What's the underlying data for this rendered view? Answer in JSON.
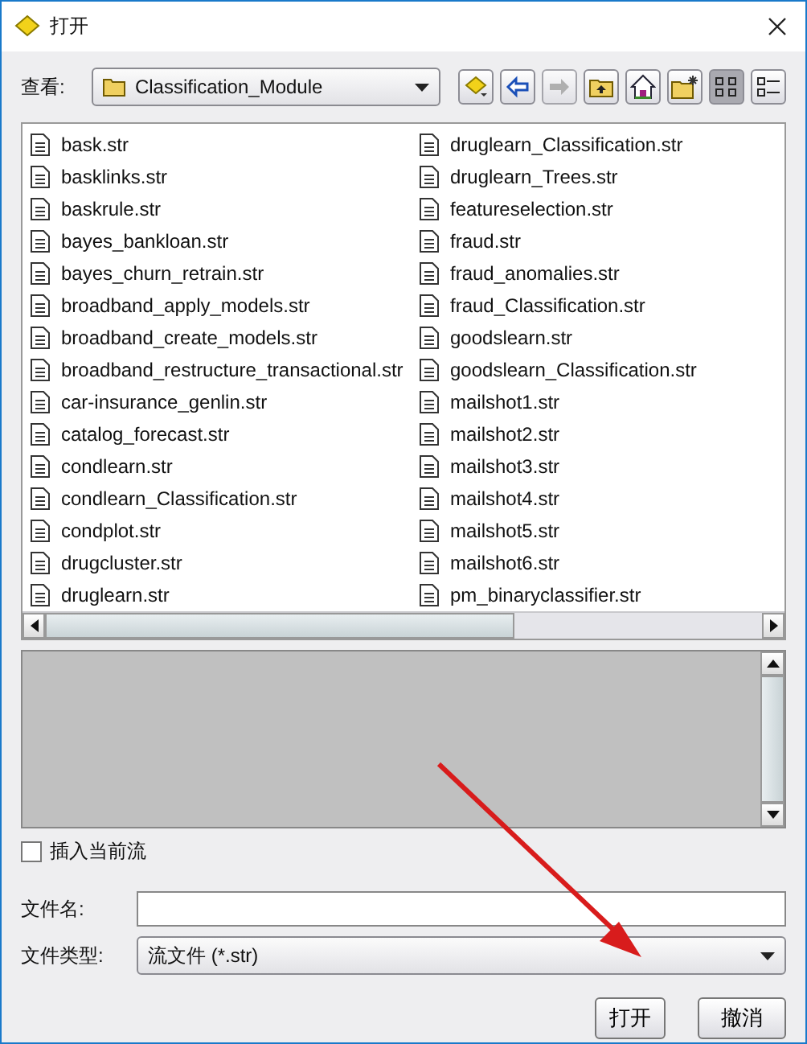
{
  "window": {
    "title": "打开"
  },
  "look_in": {
    "label": "查看:",
    "folder": "Classification_Module"
  },
  "toolbar": [
    {
      "kind": "desktop",
      "disabled": false,
      "selected": false
    },
    {
      "kind": "back",
      "disabled": false,
      "selected": false
    },
    {
      "kind": "forward",
      "disabled": true,
      "selected": false
    },
    {
      "kind": "up",
      "disabled": false,
      "selected": false
    },
    {
      "kind": "home",
      "disabled": false,
      "selected": false
    },
    {
      "kind": "newfolder",
      "disabled": false,
      "selected": false
    },
    {
      "kind": "list",
      "disabled": false,
      "selected": true
    },
    {
      "kind": "details",
      "disabled": false,
      "selected": false
    }
  ],
  "files": [
    "bask.str",
    "basklinks.str",
    "baskrule.str",
    "bayes_bankloan.str",
    "bayes_churn_retrain.str",
    "broadband_apply_models.str",
    "broadband_create_models.str",
    "broadband_restructure_transactional.str",
    "car-insurance_genlin.str",
    "catalog_forecast.str",
    "condlearn.str",
    "condlearn_Classification.str",
    "condplot.str",
    "drugcluster.str",
    "druglearn.str",
    "druglearn_Classification.str",
    "druglearn_Trees.str",
    "featureselection.str",
    "fraud.str",
    "fraud_anomalies.str",
    "fraud_Classification.str",
    "goodslearn.str",
    "goodslearn_Classification.str",
    "mailshot1.str",
    "mailshot2.str",
    "mailshot3.str",
    "mailshot4.str",
    "mailshot5.str",
    "mailshot6.str",
    "pm_binaryclassifier.str"
  ],
  "insert_checkbox": {
    "label": "插入当前流",
    "checked": false
  },
  "file_name": {
    "label": "文件名:"
  },
  "file_type": {
    "label": "文件类型:",
    "value": "流文件 (*.str)"
  },
  "buttons": [
    "打开",
    "撤消"
  ]
}
